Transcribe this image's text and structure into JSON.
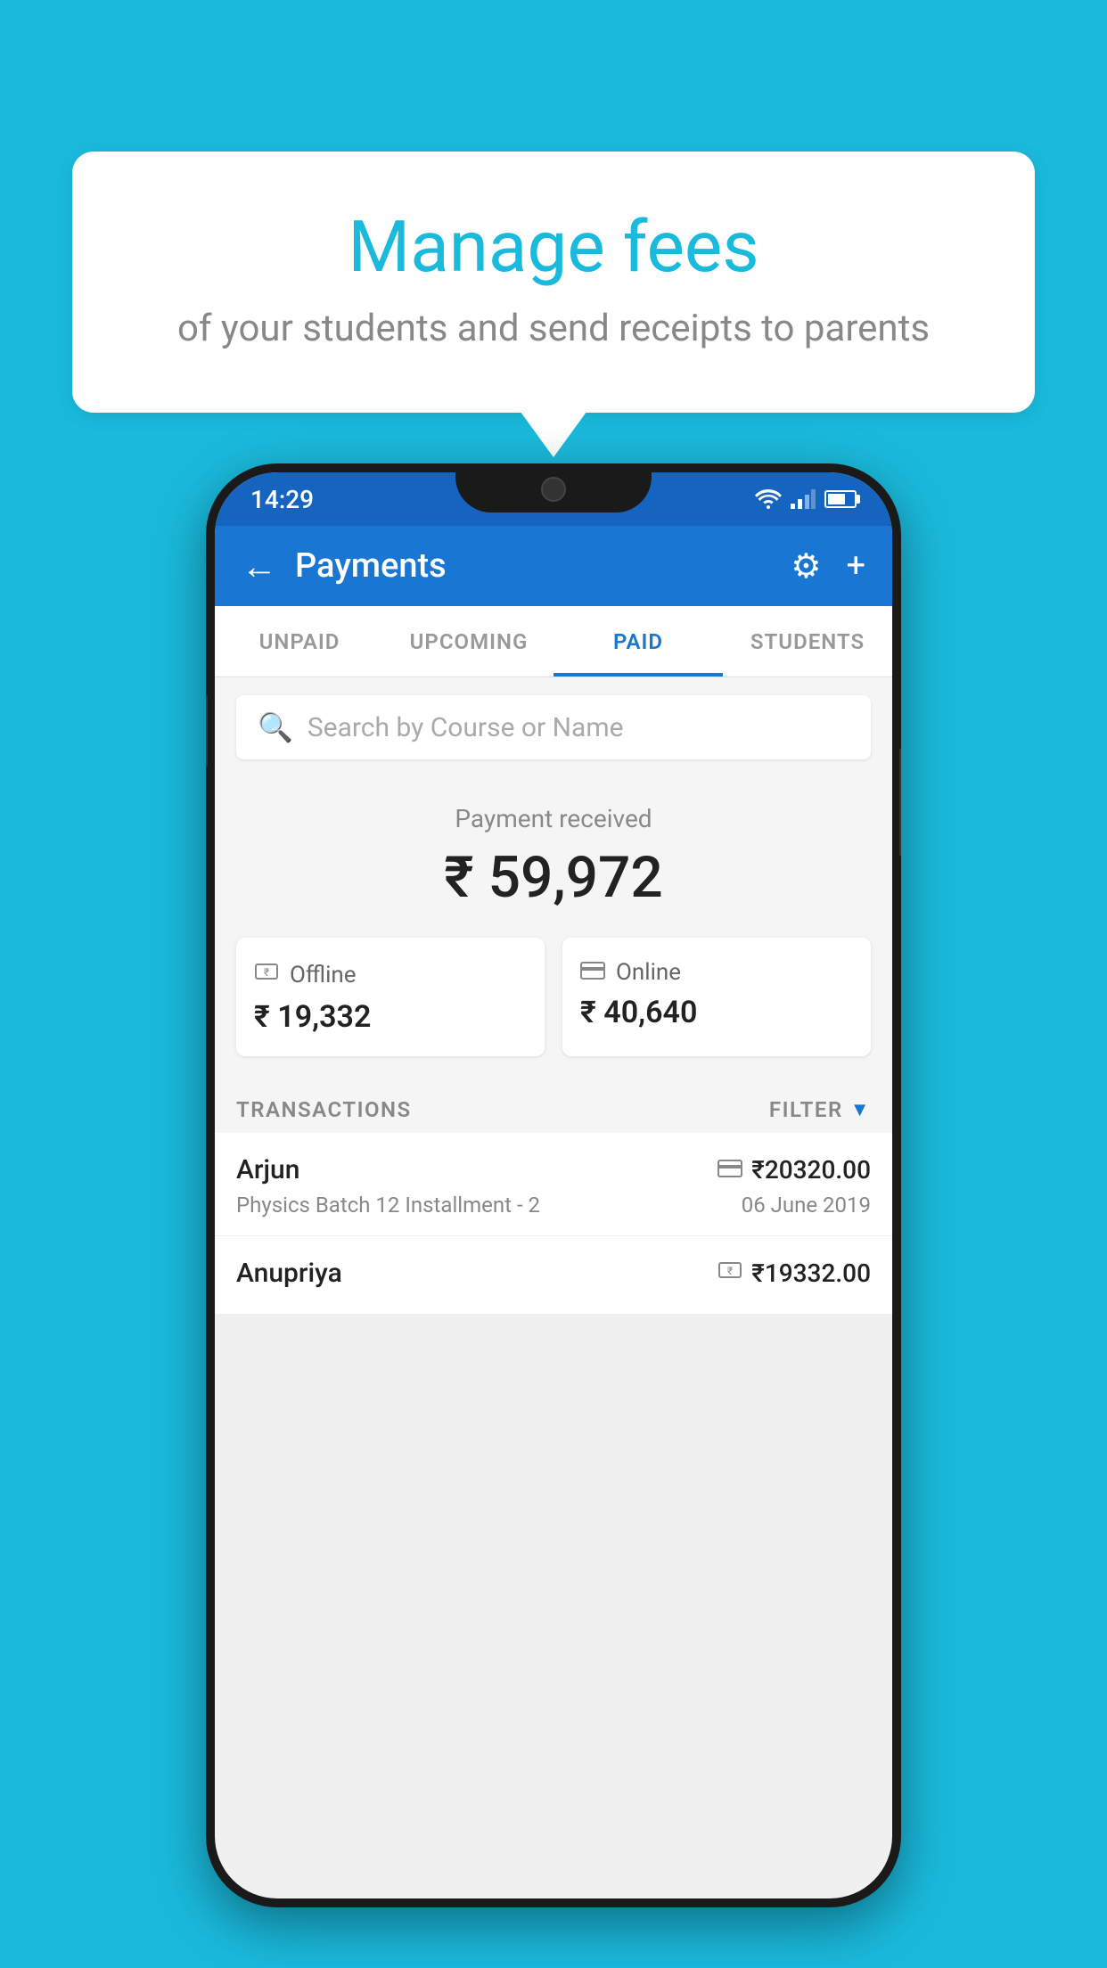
{
  "background_color": "#1ABADC",
  "bubble": {
    "title": "Manage fees",
    "subtitle": "of your students and send receipts to parents"
  },
  "status_bar": {
    "time": "14:29"
  },
  "header": {
    "title": "Payments",
    "back_label": "←",
    "settings_label": "⚙",
    "add_label": "+"
  },
  "tabs": [
    {
      "label": "UNPAID",
      "active": false
    },
    {
      "label": "UPCOMING",
      "active": false
    },
    {
      "label": "PAID",
      "active": true
    },
    {
      "label": "STUDENTS",
      "active": false
    }
  ],
  "search": {
    "placeholder": "Search by Course or Name"
  },
  "payment_summary": {
    "label": "Payment received",
    "amount": "₹ 59,972"
  },
  "payment_cards": [
    {
      "label": "Offline",
      "amount": "₹ 19,332"
    },
    {
      "label": "Online",
      "amount": "₹ 40,640"
    }
  ],
  "transactions": {
    "label": "TRANSACTIONS",
    "filter_label": "FILTER"
  },
  "transaction_list": [
    {
      "name": "Arjun",
      "detail": "Physics Batch 12 Installment - 2",
      "amount": "₹20320.00",
      "date": "06 June 2019",
      "icon": "card"
    },
    {
      "name": "Anupriya",
      "detail": "",
      "amount": "₹19332.00",
      "date": "",
      "icon": "cash"
    }
  ]
}
